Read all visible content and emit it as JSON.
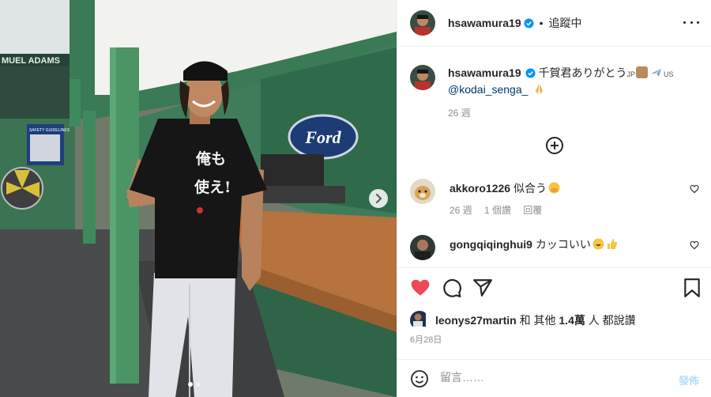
{
  "post": {
    "username": "hsawamura19",
    "follow_label": "追蹤中",
    "caption": {
      "text_main": "千賀君ありがとう",
      "flag_jp": "JP",
      "flag_us": "US",
      "mention": "@kodai_senga_",
      "emoji_names": [
        "package-emoji",
        "airplane-emoji",
        "folded-hands-emoji"
      ]
    },
    "caption_time": "26 週"
  },
  "photo": {
    "sign_text": "MUEL ADAMS",
    "shirt_text_1": "俺も",
    "shirt_text_2": "使え!",
    "logo_text": "Ford",
    "board_text": "SAFETY GUIDELINES"
  },
  "comments": [
    {
      "username": "akkoro1226",
      "text": "似合う",
      "emoji": "hands-over-mouth-emoji",
      "time": "26 週",
      "likes": "1 個讚",
      "reply": "回覆"
    },
    {
      "username": "gongqiqinghui9",
      "text": "カッコいい",
      "emoji": "grin-thumbs-up-emoji"
    }
  ],
  "likes": {
    "user": "leonys27martin",
    "rest": "和 其他",
    "count": "1.4萬",
    "suffix": "人 都說讚"
  },
  "date": "6月28日",
  "compose": {
    "placeholder": "留言……",
    "post_label": "發佈"
  },
  "colors": {
    "accent": "#0095f6",
    "heart": "#ed4956",
    "post_disabled": "#b2dffc",
    "muted": "#8e8e8e"
  }
}
